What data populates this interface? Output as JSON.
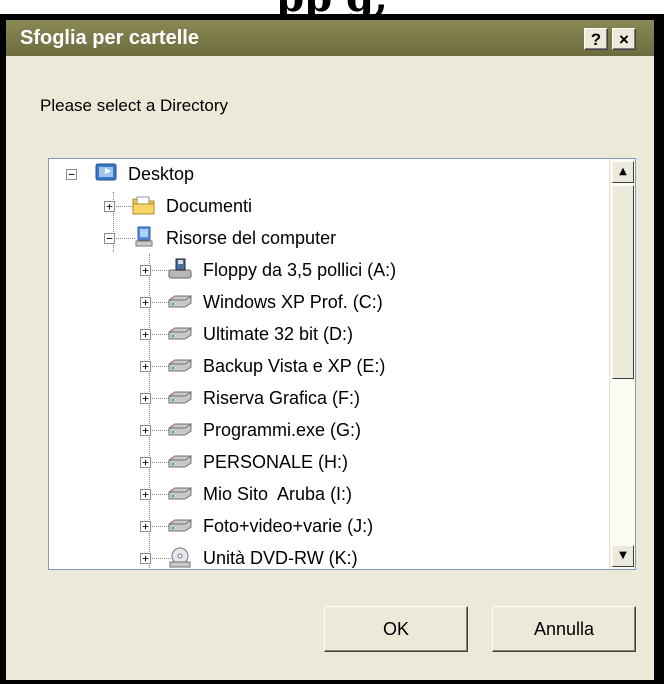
{
  "background_heading": "pp g,",
  "window": {
    "title": "Sfoglia per cartelle",
    "help_label": "?",
    "close_label": "×",
    "prompt": "Please select a Directory"
  },
  "tree": {
    "root": {
      "label": "Desktop",
      "expander": "−",
      "icon": "desktop-icon"
    },
    "children": [
      {
        "label": "Documenti",
        "expander": "+",
        "icon": "documents-folder-icon"
      },
      {
        "label": "Risorse del computer",
        "expander": "−",
        "icon": "my-computer-icon"
      }
    ],
    "drives": [
      {
        "label": "Floppy da 3,5 pollici (A:)",
        "expander": "+",
        "icon": "floppy-drive-icon"
      },
      {
        "label": "Windows XP Prof. (C:)",
        "expander": "+",
        "icon": "hard-drive-icon"
      },
      {
        "label": "Ultimate 32 bit (D:)",
        "expander": "+",
        "icon": "hard-drive-icon"
      },
      {
        "label": "Backup Vista e XP (E:)",
        "expander": "+",
        "icon": "hard-drive-icon"
      },
      {
        "label": "Riserva Grafica (F:)",
        "expander": "+",
        "icon": "hard-drive-icon"
      },
      {
        "label": "Programmi.exe (G:)",
        "expander": "+",
        "icon": "hard-drive-icon"
      },
      {
        "label": "PERSONALE (H:)",
        "expander": "+",
        "icon": "hard-drive-icon"
      },
      {
        "label": "Mio Sito  Aruba (I:)",
        "expander": "+",
        "icon": "hard-drive-icon"
      },
      {
        "label": "Foto+video+varie (J:)",
        "expander": "+",
        "icon": "hard-drive-icon"
      },
      {
        "label": "Unità DVD-RW (K:)",
        "expander": "+",
        "icon": "dvd-drive-icon"
      }
    ]
  },
  "scrollbar": {
    "up_arrow": "▲",
    "down_arrow": "▼"
  },
  "buttons": {
    "ok": "OK",
    "cancel": "Annulla"
  },
  "colors": {
    "titlebar": "#6b6b3e",
    "dialog": "#ece9d8",
    "tree_border": "#7f9db9"
  }
}
